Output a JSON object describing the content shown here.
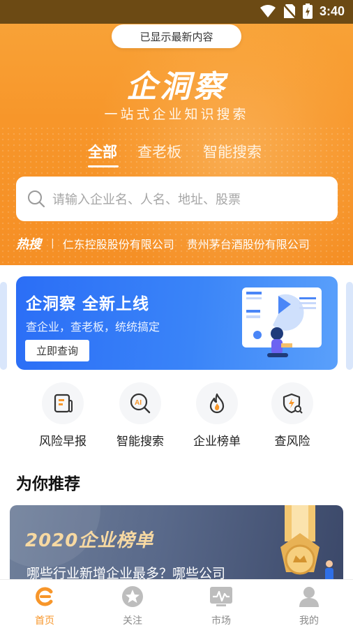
{
  "status_bar": {
    "time": "3:40"
  },
  "toast": "已显示最新内容",
  "brand": {
    "title": "企洞察",
    "subtitle": "一站式企业知识搜索"
  },
  "tabs": [
    {
      "label": "全部",
      "active": true
    },
    {
      "label": "查老板",
      "active": false
    },
    {
      "label": "智能搜索",
      "active": false
    }
  ],
  "search": {
    "placeholder": "请输入企业名、人名、地址、股票"
  },
  "hot": {
    "label": "热搜",
    "separator": "|",
    "items": [
      "仁东控股股份有限公司",
      "贵州茅台酒股份有限公司"
    ]
  },
  "banner": {
    "title": "企洞察  全新上线",
    "description": "查企业，查老板，统统搞定",
    "button": "立即查询"
  },
  "quick_actions": [
    {
      "label": "风险早报",
      "icon": "report-icon"
    },
    {
      "label": "智能搜索",
      "icon": "ai-search-icon"
    },
    {
      "label": "企业榜单",
      "icon": "flame-icon"
    },
    {
      "label": "查风险",
      "icon": "risk-shield-icon"
    }
  ],
  "section": {
    "title": "为你推荐"
  },
  "recommend": {
    "title": "2020企业榜单",
    "description": "哪些行业新增企业最多？哪些公司"
  },
  "bottom_nav": [
    {
      "label": "首页",
      "icon": "home-logo-icon",
      "active": true
    },
    {
      "label": "关注",
      "icon": "star-icon",
      "active": false
    },
    {
      "label": "市场",
      "icon": "market-chart-icon",
      "active": false
    },
    {
      "label": "我的",
      "icon": "user-icon",
      "active": false
    }
  ],
  "colors": {
    "accent": "#f7962a",
    "banner_blue": "#2b6ef6",
    "nav_inactive": "#8a8a8a"
  }
}
